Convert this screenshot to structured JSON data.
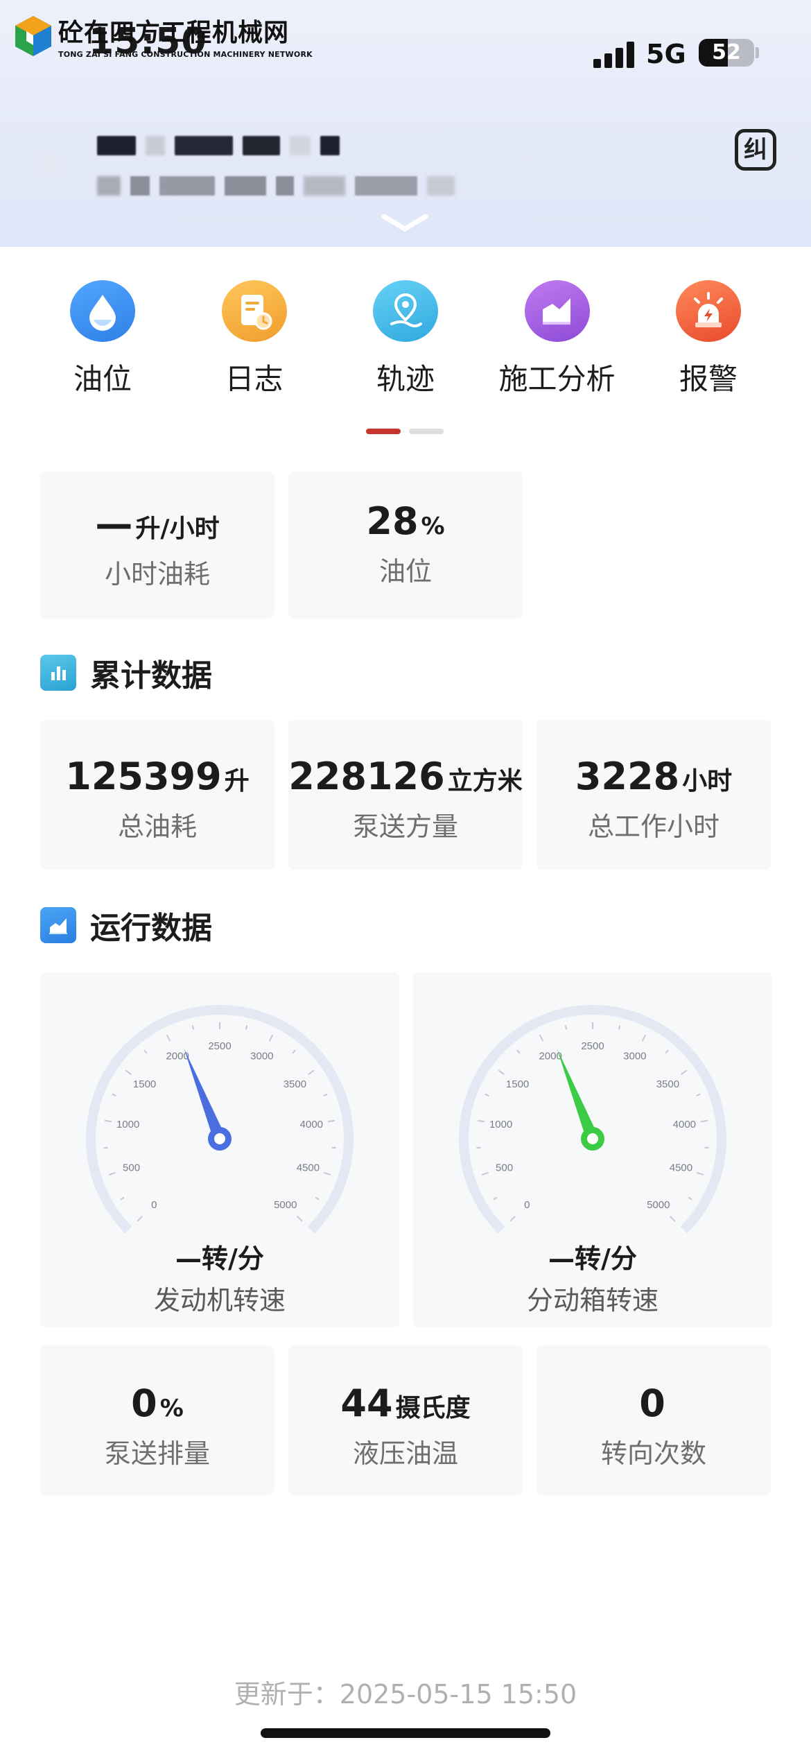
{
  "status_bar": {
    "time": "15:50",
    "network": "5G",
    "battery": "52",
    "battery_level_percent": 52
  },
  "watermark": {
    "name_cn": "砼在四方工程机械网",
    "name_en": "TONG ZAI SI FANG CONSTRUCTION MACHINERY NETWORK"
  },
  "header": {
    "correct_label": "纠"
  },
  "functions": [
    {
      "label": "油位",
      "icon": "oil-drop-icon",
      "color": "#3b8ef0"
    },
    {
      "label": "日志",
      "icon": "log-document-icon",
      "color": "#f0a93a"
    },
    {
      "label": "轨迹",
      "icon": "location-pin-icon",
      "color": "#3cb6e8"
    },
    {
      "label": "施工分析",
      "icon": "construction-chart-icon",
      "color": "#a45ee0"
    },
    {
      "label": "报警",
      "icon": "alarm-light-icon",
      "color": "#ee5a35"
    }
  ],
  "pager": {
    "active_color": "#c8352c",
    "inactive_color": "#dedede"
  },
  "realtime": [
    {
      "value": "—",
      "unit": "升/小时",
      "label": "小时油耗"
    },
    {
      "value": "28",
      "unit": "%",
      "label": "油位"
    }
  ],
  "cumulative": {
    "title": "累计数据",
    "items": [
      {
        "value": "125399",
        "unit": "升",
        "label": "总油耗"
      },
      {
        "value": "228126",
        "unit": "立方米",
        "label": "泵送方量"
      },
      {
        "value": "3228",
        "unit": "小时",
        "label": "总工作小时"
      }
    ]
  },
  "operation": {
    "title": "运行数据",
    "gauges": [
      {
        "value": "—",
        "unit": "转/分",
        "label": "发动机转速",
        "color": "#4a6ee0",
        "reading": 2100,
        "ticks": [
          "0",
          "500",
          "1000",
          "1500",
          "2000",
          "2500",
          "3000",
          "3500",
          "4000",
          "4500",
          "5000"
        ]
      },
      {
        "value": "—",
        "unit": "转/分",
        "label": "分动箱转速",
        "color": "#3ccb44",
        "reading": 2100,
        "ticks": [
          "0",
          "500",
          "1000",
          "1500",
          "2000",
          "2500",
          "3000",
          "3500",
          "4000",
          "4500",
          "5000"
        ]
      }
    ],
    "items": [
      {
        "value": "0",
        "unit": "%",
        "label": "泵送排量"
      },
      {
        "value": "44",
        "unit": "摄氏度",
        "label": "液压油温"
      },
      {
        "value": "0",
        "unit": "",
        "label": "转向次数"
      }
    ]
  },
  "footer": {
    "update_text": "更新于：2025-05-15 15:50"
  }
}
